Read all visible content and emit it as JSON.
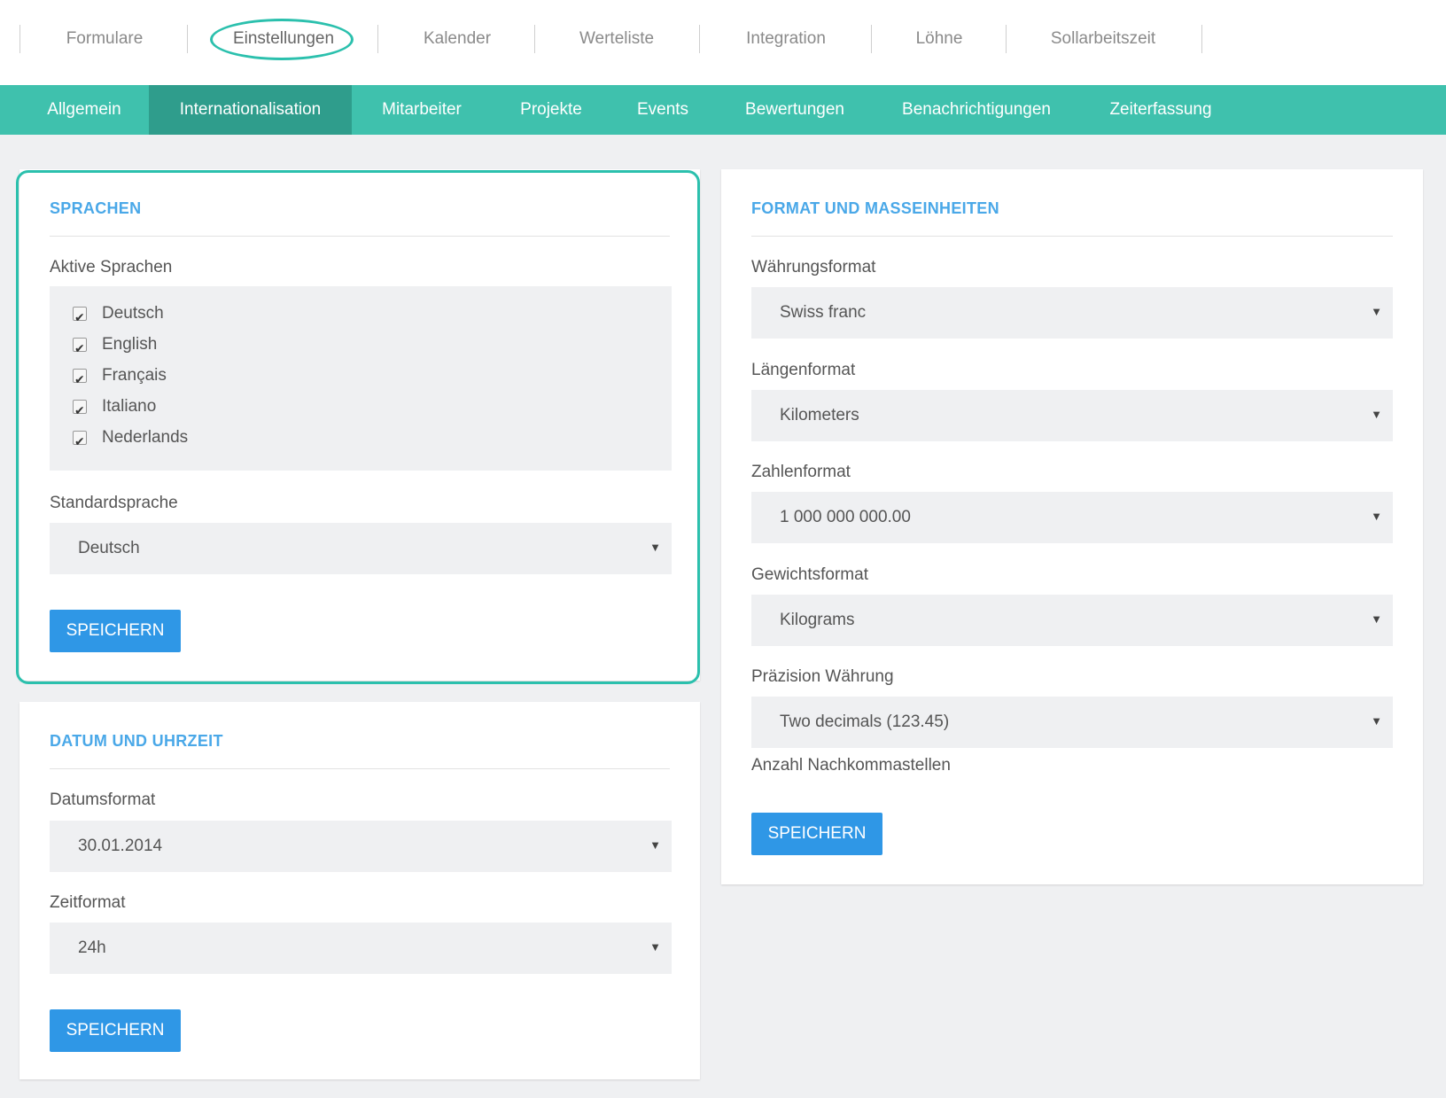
{
  "top_nav": {
    "items": [
      "Formulare",
      "Einstellungen",
      "Kalender",
      "Werteliste",
      "Integration",
      "Löhne",
      "Sollarbeitszeit"
    ]
  },
  "sub_nav": {
    "items": [
      "Allgemein",
      "Internationalisation",
      "Mitarbeiter",
      "Projekte",
      "Events",
      "Bewertungen",
      "Benachrichtigungen",
      "Zeiterfassung"
    ]
  },
  "languages_card": {
    "title": "SPRACHEN",
    "active_label": "Aktive Sprachen",
    "languages": [
      {
        "name": "Deutsch",
        "checked": true
      },
      {
        "name": "English",
        "checked": true
      },
      {
        "name": "Français",
        "checked": true
      },
      {
        "name": "Italiano",
        "checked": true
      },
      {
        "name": "Nederlands",
        "checked": true
      }
    ],
    "default_label": "Standardsprache",
    "default_value": "Deutsch",
    "save_label": "SPEICHERN"
  },
  "datetime_card": {
    "title": "DATUM UND UHRZEIT",
    "date_label": "Datumsformat",
    "date_value": "30.01.2014",
    "time_label": "Zeitformat",
    "time_value": "24h",
    "save_label": "SPEICHERN"
  },
  "format_card": {
    "title": "FORMAT UND MASSEINHEITEN",
    "currency_label": "Währungsformat",
    "currency_value": "Swiss franc",
    "length_label": "Längenformat",
    "length_value": "Kilometers",
    "number_label": "Zahlenformat",
    "number_value": "1 000 000 000.00",
    "weight_label": "Gewichtsformat",
    "weight_value": "Kilograms",
    "precision_label": "Präzision Währung",
    "precision_value": "Two decimals (123.45)",
    "precision_hint": "Anzahl Nachkommastellen",
    "save_label": "SPEICHERN"
  },
  "icons": {
    "dropdown": "caret-down-icon",
    "checkbox": "checkbox-checked-icon"
  },
  "colors": {
    "accent": "#3fc1ad",
    "accent_dark": "#2f9d8c",
    "highlight": "#2bc0ad",
    "button": "#2f97e6",
    "card_title": "#4aa8e8"
  }
}
